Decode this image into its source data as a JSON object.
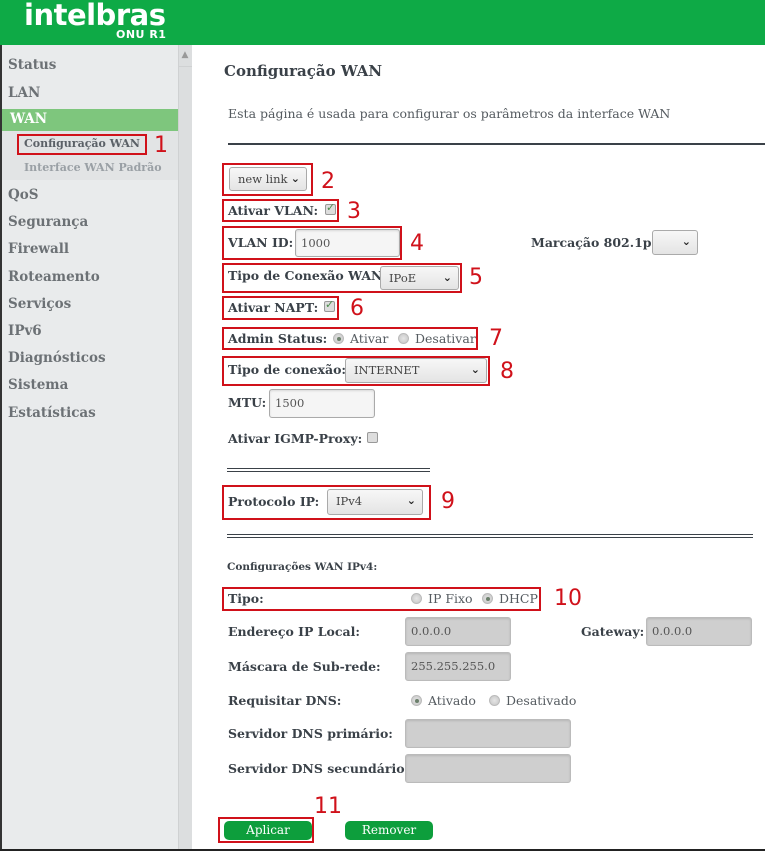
{
  "header": {
    "brand": "intelbras",
    "model": "ONU R1",
    "brand_color": "#0eaa46"
  },
  "sidebar": {
    "items": [
      {
        "label": "Status"
      },
      {
        "label": "LAN"
      },
      {
        "label": "WAN",
        "active": true
      },
      {
        "label": "QoS"
      },
      {
        "label": "Segurança"
      },
      {
        "label": "Firewall"
      },
      {
        "label": "Roteamento"
      },
      {
        "label": "Serviços"
      },
      {
        "label": "IPv6"
      },
      {
        "label": "Diagnósticos"
      },
      {
        "label": "Sistema"
      },
      {
        "label": "Estatísticas"
      }
    ],
    "submenu": [
      {
        "label": "Configuração WAN",
        "current": true
      },
      {
        "label": "Interface WAN Padrão"
      }
    ]
  },
  "page": {
    "title": "Configuração WAN",
    "description": "Esta página é usada para configurar os parâmetros da interface WAN"
  },
  "form": {
    "link_select": "new link",
    "vlan_enable": {
      "label": "Ativar VLAN:",
      "checked": true
    },
    "vlan_id": {
      "label": "VLAN ID:",
      "value": "1000"
    },
    "marking_8021p": {
      "label": "Marcação 802.1p",
      "value": ""
    },
    "wan_connection_type": {
      "label": "Tipo de Conexão WAN:",
      "value": "IPoE"
    },
    "napt_enable": {
      "label": "Ativar NAPT:",
      "checked": true
    },
    "admin_status": {
      "label": "Admin Status:",
      "options": [
        "Ativar",
        "Desativar"
      ],
      "selected": "Ativar"
    },
    "connection_type": {
      "label": "Tipo de conexão:",
      "value": "INTERNET"
    },
    "mtu": {
      "label": "MTU:",
      "value": "1500"
    },
    "igmp_proxy": {
      "label": "Ativar IGMP-Proxy:",
      "checked": false
    },
    "ip_protocol": {
      "label": "Protocolo IP:",
      "value": "IPv4"
    },
    "ipv4_section_title": "Configurações WAN IPv4:",
    "type": {
      "label": "Tipo:",
      "options": [
        "IP Fixo",
        "DHCP"
      ],
      "selected": "DHCP"
    },
    "local_ip": {
      "label": "Endereço IP Local:",
      "value": "0.0.0.0"
    },
    "gateway": {
      "label": "Gateway:",
      "value": "0.0.0.0"
    },
    "subnet_mask": {
      "label": "Máscara de Sub-rede:",
      "value": "255.255.255.0"
    },
    "request_dns": {
      "label": "Requisitar DNS:",
      "options": [
        "Ativado",
        "Desativado"
      ],
      "selected": "Ativado"
    },
    "dns_primary": {
      "label": "Servidor DNS primário:",
      "value": ""
    },
    "dns_secondary": {
      "label": "Servidor DNS secundário:",
      "value": ""
    },
    "apply_label": "Aplicar",
    "remove_label": "Remover"
  },
  "annotations": [
    "1",
    "2",
    "3",
    "4",
    "5",
    "6",
    "7",
    "8",
    "9",
    "10",
    "11"
  ]
}
